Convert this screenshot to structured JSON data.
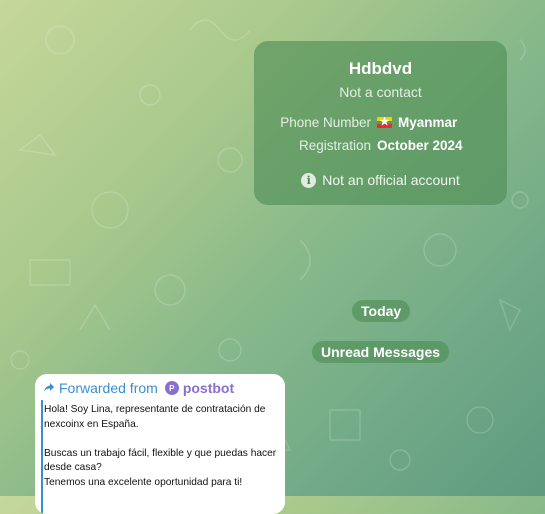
{
  "contact_card": {
    "name": "Hdbdvd",
    "subtitle": "Not a contact",
    "phone_label": "Phone Number",
    "phone_flag": "myanmar-flag",
    "phone_value": "Myanmar",
    "registration_label": "Registration",
    "registration_value": "October 2024",
    "official_notice": "Not an official account"
  },
  "date_pill": "Today",
  "unread_label": "Unread Messages",
  "message": {
    "forwarded_prefix": "Forwarded from",
    "bot_initial": "P",
    "bot_name": "postbot",
    "line1": "Hola! Soy Lina, representante de contratación de nexcoinx en España.",
    "line2": "Buscas un trabajo fácil, flexible y que puedas hacer desde casa?",
    "line3": "Tenemos una excelente oportunidad para ti!"
  }
}
